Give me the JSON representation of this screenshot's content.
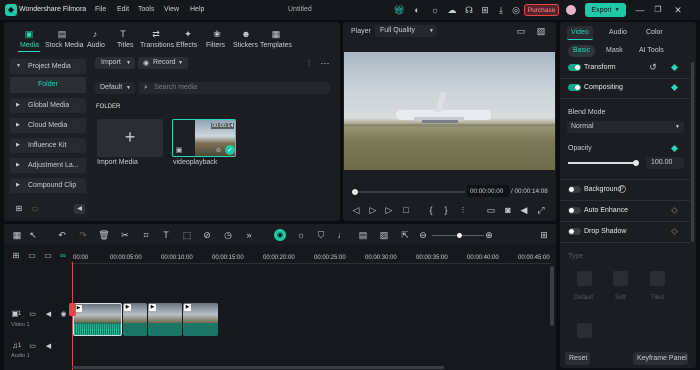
{
  "app": {
    "name": "Wondershare Filmora",
    "menu": [
      "File",
      "Edit",
      "Tools",
      "View",
      "Help"
    ],
    "doc_title": "Untitled",
    "purchase": "Purchase",
    "export": "Export"
  },
  "media_tabs": [
    "Media",
    "Stock Media",
    "Audio",
    "Titles",
    "Transitions",
    "Effects",
    "Filters",
    "Stickers",
    "Templates"
  ],
  "sidebar": {
    "items": [
      "Project Media",
      "Folder",
      "Global Media",
      "Cloud Media",
      "Influence Kit",
      "Adjustment La...",
      "Compound Clip"
    ]
  },
  "library": {
    "import_label": "Import",
    "record_label": "Record",
    "sort_value": "Default",
    "search_placeholder": "Search media",
    "folder_label": "FOLDER",
    "import_media": "Import Media",
    "clip_name": "videoplayback",
    "clip_duration": "00:00:14"
  },
  "player": {
    "label": "Player",
    "quality": "Full Quality",
    "current_time": "00:00:00:00",
    "total_time": "/ 00:00:14:08",
    "progress": 0.0
  },
  "right_panel": {
    "tabs": [
      "Video",
      "Audio",
      "Color"
    ],
    "subtabs": [
      "Basic",
      "Mask",
      "AI Tools"
    ],
    "transform": "Transform",
    "compositing": "Compositing",
    "blend_mode_label": "Blend Mode",
    "blend_mode_value": "Normal",
    "opacity_label": "Opacity",
    "opacity_value": "100.00",
    "opacity_level": 1.0,
    "background": "Background",
    "auto_enhance": "Auto Enhance",
    "drop_shadow": "Drop Shadow",
    "type_label": "Type",
    "shadow_types": [
      "Default",
      "Soft",
      "Tiled"
    ],
    "reset": "Reset",
    "keyframe_panel": "Keyframe Panel"
  },
  "timeline": {
    "ruler": [
      "00:00",
      "00:00:05:00",
      "00:00:10:00",
      "00:00:15:00",
      "00:00:20:00",
      "00:00:25:00",
      "00:00:30:00",
      "00:00:35:00",
      "00:00:40:00",
      "00:00:45:00"
    ],
    "video_track": "Video 1",
    "audio_track": "Audio 1",
    "video_track_num": "1",
    "audio_track_num": "1"
  },
  "colors": {
    "accent": "#28d5b4",
    "purchase": "#e0474c",
    "playhead": "#e04848"
  }
}
